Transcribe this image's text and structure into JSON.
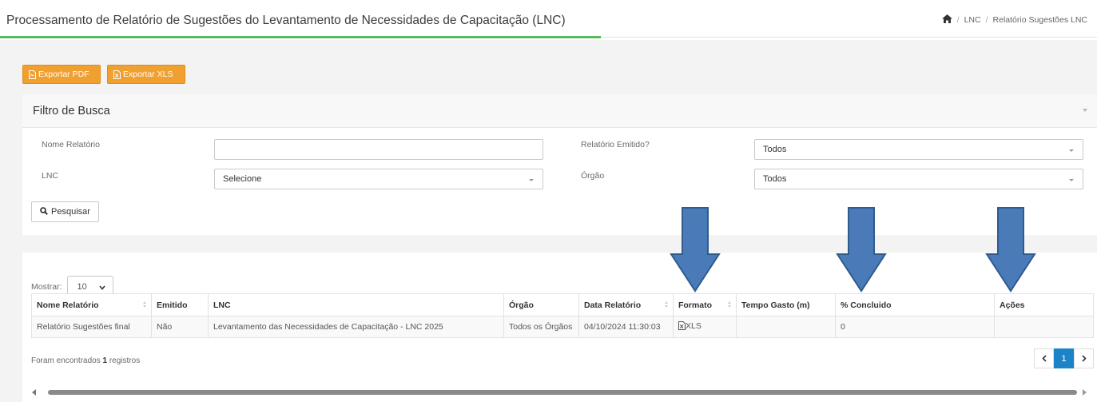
{
  "header": {
    "title": "Processamento de Relatório de Sugestões do Levantamento de Necessidades de Capacitação (LNC)",
    "breadcrumb": [
      "LNC",
      "Relatório Sugestões LNC"
    ],
    "separator": "/"
  },
  "toolbar": {
    "export_pdf": "Exportar PDF",
    "export_xls": "Exportar XLS",
    "accent_color": "#f0a030"
  },
  "filter": {
    "title": "Filtro de Busca",
    "nome_relatorio_label": "Nome Relatório",
    "nome_relatorio_value": "",
    "lnc_label": "LNC",
    "lnc_value": "Selecione",
    "emitido_label": "Relatório Emitido?",
    "emitido_value": "Todos",
    "orgao_label": "Órgão",
    "orgao_value": "Todos",
    "search_button": "Pesquisar"
  },
  "results": {
    "show_label": "Mostrar:",
    "page_size": "10",
    "columns": [
      "Nome Relatório",
      "Emitido",
      "LNC",
      "Órgão",
      "Data Relatório",
      "Formato",
      "Tempo Gasto (m)",
      "% Concluido",
      "Ações"
    ],
    "rows": [
      {
        "nome": "Relatório Sugestões final",
        "emitido": "Não",
        "lnc": "Levantamento das Necessidades de Capacitação - LNC 2025",
        "orgao": "Todos os Órgãos",
        "data": "04/10/2024 11:30:03",
        "formato": "XLS",
        "tempo": "",
        "concluido": "0",
        "acoes": ""
      }
    ],
    "records_prefix": "Foram encontrados",
    "records_count": "1",
    "records_suffix": "registros",
    "current_page": "1",
    "active_color": "#1c84c6"
  },
  "annotations": {
    "arrow_color": "#4a7ab8",
    "arrow_icon": "down-arrow-icon"
  }
}
